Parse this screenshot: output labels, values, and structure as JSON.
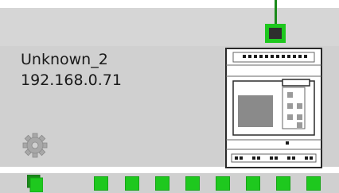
{
  "device": {
    "name": "Unknown_2",
    "ip": "192.168.0.71"
  },
  "icons": {
    "settings": "gear-icon",
    "device": "plc-device-icon",
    "port": "network-port-icon"
  },
  "io_ports": {
    "count": 9
  },
  "colors": {
    "port_green": "#1ec81e",
    "link_green": "#1a8a1a",
    "panel_gray": "#d0d0d0"
  }
}
